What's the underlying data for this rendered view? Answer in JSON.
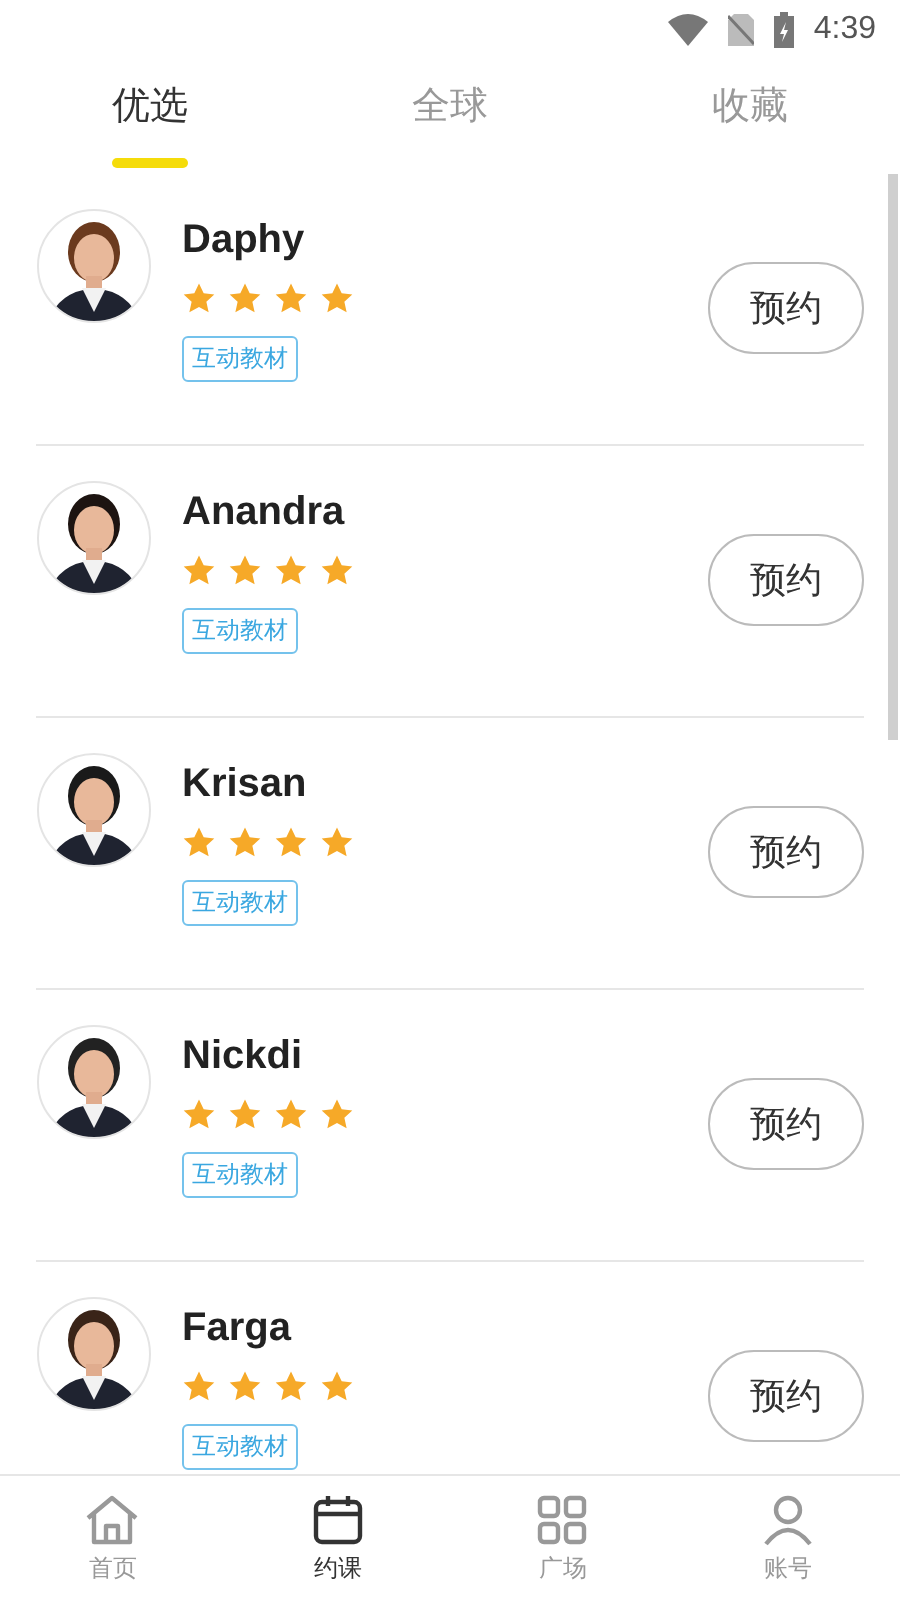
{
  "status_bar": {
    "time": "4:39"
  },
  "tabs": [
    {
      "label": "优选",
      "selected": true
    },
    {
      "label": "全球",
      "selected": false
    },
    {
      "label": "收藏",
      "selected": false
    }
  ],
  "teachers": [
    {
      "name": "Daphy",
      "stars": 4,
      "tag": "互动教材",
      "button": "预约"
    },
    {
      "name": "Anandra",
      "stars": 4,
      "tag": "互动教材",
      "button": "预约"
    },
    {
      "name": "Krisan",
      "stars": 4,
      "tag": "互动教材",
      "button": "预约"
    },
    {
      "name": "Nickdi",
      "stars": 4,
      "tag": "互动教材",
      "button": "预约"
    },
    {
      "name": "Farga",
      "stars": 4,
      "tag": "互动教材",
      "button": "预约"
    }
  ],
  "bottom_nav": [
    {
      "label": "首页",
      "selected": false,
      "kind": "home"
    },
    {
      "label": "约课",
      "selected": true,
      "kind": "book"
    },
    {
      "label": "广场",
      "selected": false,
      "kind": "square"
    },
    {
      "label": "账号",
      "selected": false,
      "kind": "account"
    }
  ]
}
